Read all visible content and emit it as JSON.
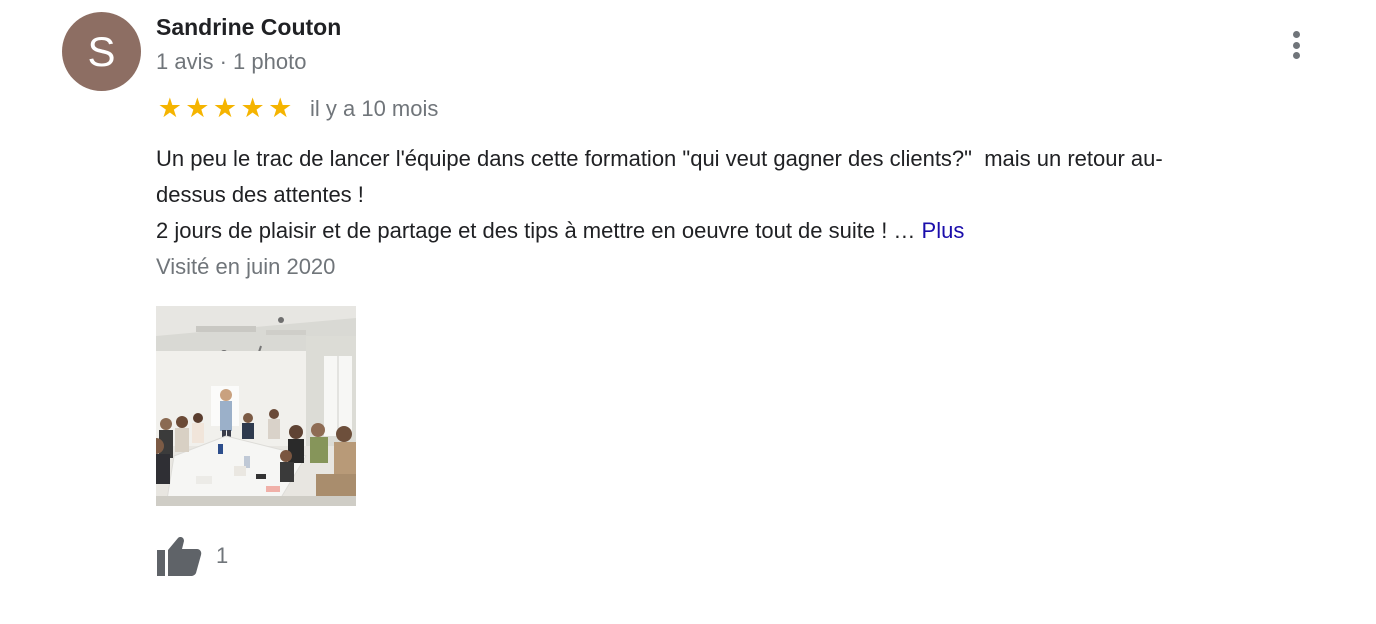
{
  "review": {
    "author": {
      "initial": "S",
      "name": "Sandrine Couton",
      "meta": "1 avis · 1 photo",
      "avatar_color": "#8d6e63"
    },
    "rating": {
      "stars": 5,
      "max": 5,
      "star_glyph": "★",
      "star_color": "#f5b400"
    },
    "date": "il y a 10 mois",
    "text": {
      "line1": "Un peu le trac de lancer l'équipe dans cette formation \"qui veut gagner des clients?\"  mais un retour au-",
      "line2": "dessus des attentes !",
      "line3": "2 jours de plaisir et de partage et des tips à mettre en oeuvre tout de suite ! … ",
      "more_label": "Plus"
    },
    "visited": "Visité en juin 2020",
    "likes": {
      "count": "1",
      "icon": "thumb-up-icon"
    },
    "menu_icon": "more-vert-icon",
    "colors": {
      "secondary_text": "#70757a",
      "link": "#1a0dab",
      "primary_text": "#202124"
    }
  }
}
